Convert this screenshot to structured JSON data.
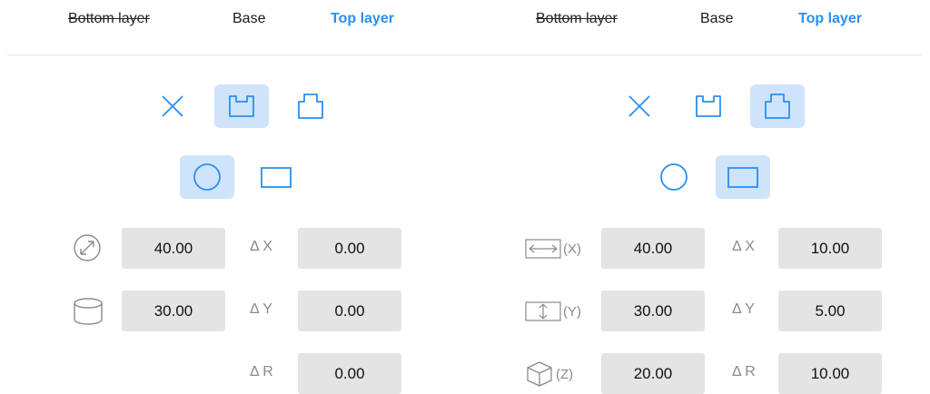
{
  "left_panel": {
    "tabs": {
      "bottom": "Bottom layer",
      "base": "Base",
      "top": "Top layer"
    },
    "diameter_value": "40.00",
    "height_value": "30.00",
    "dx_label": "Δ X",
    "dx_value": "0.00",
    "dy_label": "Δ Y",
    "dy_value": "0.00",
    "dr_label": "Δ R",
    "dr_value": "0.00"
  },
  "right_panel": {
    "tabs": {
      "bottom": "Bottom layer",
      "base": "Base",
      "top": "Top layer"
    },
    "x_label": "(X)",
    "x_value": "40.00",
    "y_label": "(Y)",
    "y_value": "30.00",
    "z_label": "(Z)",
    "z_value": "20.00",
    "dx_label": "Δ X",
    "dx_value": "10.00",
    "dy_label": "Δ Y",
    "dy_value": "5.00",
    "dr_label": "Δ R",
    "dr_value": "10.00"
  },
  "colors": {
    "accent": "#2a8ff0",
    "selected_bg": "#cfe3fb",
    "field_bg": "#e4e4e4",
    "muted": "#8a8a8a"
  },
  "icons": [
    "close-icon",
    "recess-icon",
    "protrusion-icon",
    "circle-icon",
    "rectangle-icon",
    "diameter-icon",
    "cylinder-icon",
    "width-icon",
    "depth-icon",
    "box-icon"
  ]
}
